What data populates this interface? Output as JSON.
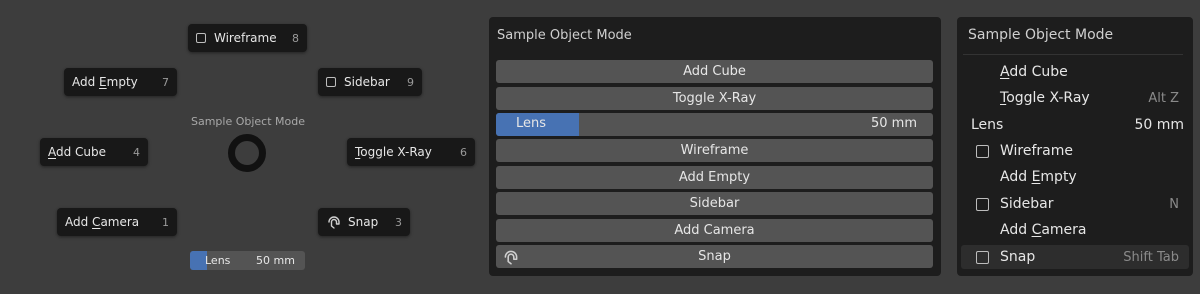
{
  "pie": {
    "title": "Sample Object Mode",
    "items": {
      "wireframe": {
        "label": "Wireframe",
        "num": "8"
      },
      "add_empty": {
        "pre": "Add ",
        "ul": "E",
        "post": "mpty",
        "num": "7"
      },
      "sidebar": {
        "label": "Sidebar",
        "num": "9"
      },
      "add_cube": {
        "ul": "A",
        "post": "dd Cube",
        "num": "4"
      },
      "toggle_xray": {
        "ul": "T",
        "post": "oggle X-Ray",
        "num": "6"
      },
      "add_camera": {
        "pre": "Add ",
        "ul": "C",
        "post": "amera",
        "num": "1"
      },
      "snap": {
        "label": "Snap",
        "num": "3"
      }
    },
    "lens": {
      "label": "Lens",
      "value": "50 mm",
      "fill_fraction": 0.15
    }
  },
  "panel_buttons": {
    "title": "Sample Object Mode",
    "add_cube": "Add Cube",
    "toggle_xray": "Toggle X-Ray",
    "lens_label": "Lens",
    "lens_value": "50 mm",
    "lens_fill_fraction": 0.19,
    "wireframe": "Wireframe",
    "add_empty": "Add Empty",
    "sidebar": "Sidebar",
    "add_camera": "Add Camera",
    "snap": "Snap"
  },
  "panel_menu": {
    "title": "Sample Object Mode",
    "add_cube": {
      "ul": "A",
      "post": "dd Cube"
    },
    "toggle_xray": {
      "ul": "T",
      "post": "oggle X-Ray",
      "shortcut": "Alt Z"
    },
    "lens": {
      "label": "Lens",
      "value": "50 mm"
    },
    "wireframe": {
      "label": "Wireframe"
    },
    "add_empty": {
      "pre": "Add ",
      "ul": "E",
      "post": "mpty"
    },
    "sidebar": {
      "label": "Sidebar",
      "shortcut": "N"
    },
    "add_camera": {
      "pre": "Add ",
      "ul": "C",
      "post": "amera"
    },
    "snap": {
      "label": "Snap",
      "shortcut": "Shift Tab"
    }
  },
  "colors": {
    "accent": "#4772b3",
    "background": "#3d3d3d",
    "panel": "#1d1d1d",
    "button": "#545454"
  }
}
